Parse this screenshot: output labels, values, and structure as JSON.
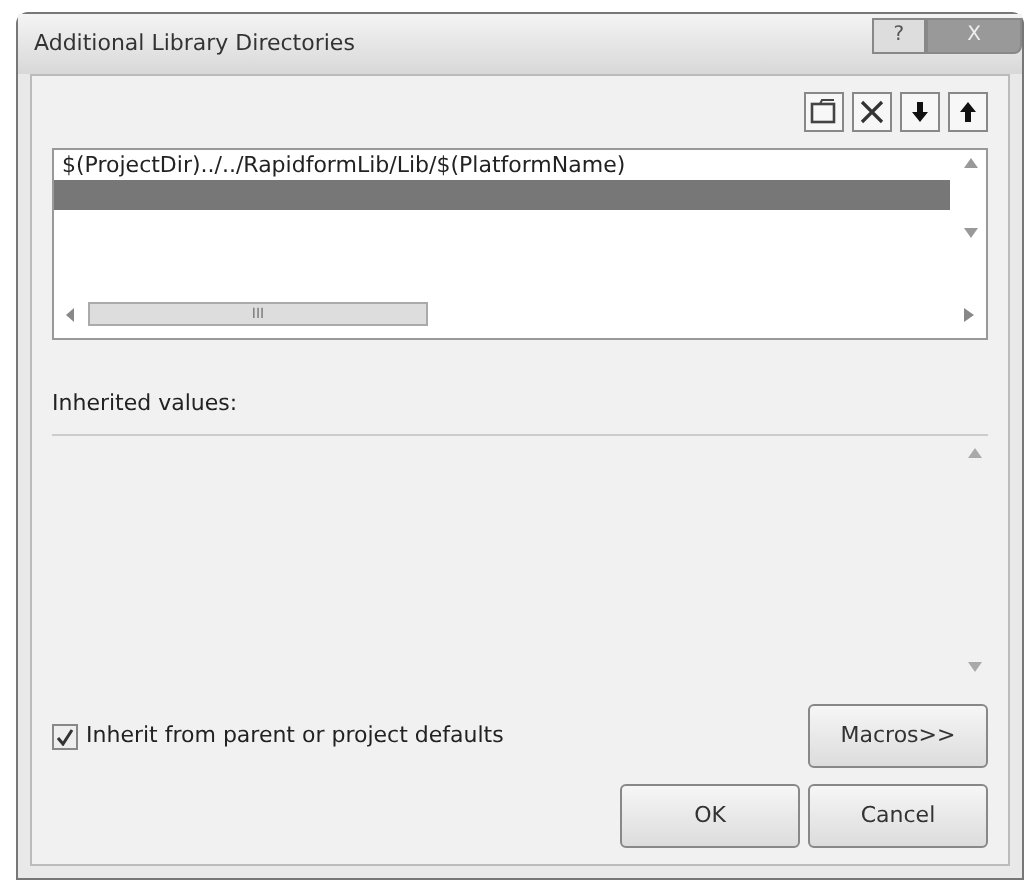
{
  "window": {
    "title": "Additional Library Directories",
    "controls": [
      "?",
      "X"
    ]
  },
  "toolbar": [
    {
      "kind": "folder"
    },
    {
      "kind": "delete"
    },
    {
      "kind": "down"
    },
    {
      "kind": "up"
    }
  ],
  "entries": [
    {
      "text": "$(ProjectDir)../../RapidformLib/Lib/$(PlatformName)",
      "selected": false
    },
    {
      "selected": true
    }
  ],
  "hscroll": {
    "center_mark": "III"
  },
  "inherited": {
    "label": "Inherited values:"
  },
  "inherit_checkbox": {
    "label": "Inherit from parent or project defaults",
    "checked": true
  },
  "buttons": {
    "macros": "Macros>>",
    "ok": "OK",
    "cancel": "Cancel"
  }
}
